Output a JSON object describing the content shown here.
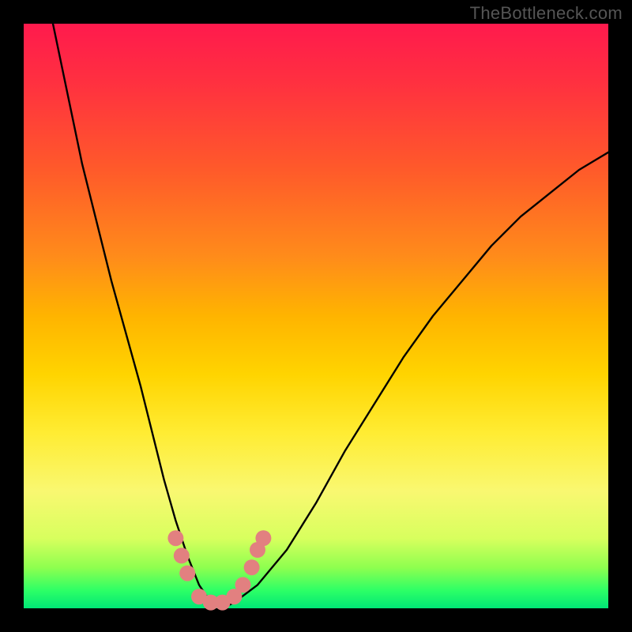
{
  "watermark": "TheBottleneck.com",
  "chart_data": {
    "type": "line",
    "title": "",
    "xlabel": "",
    "ylabel": "",
    "xlim": [
      0,
      100
    ],
    "ylim": [
      0,
      100
    ],
    "grid": false,
    "legend": false,
    "series": [
      {
        "name": "bottleneck-curve",
        "color": "#000000",
        "x": [
          5,
          10,
          15,
          20,
          24,
          26,
          28,
          30,
          32,
          34,
          36,
          40,
          45,
          50,
          55,
          60,
          65,
          70,
          75,
          80,
          85,
          90,
          95,
          100
        ],
        "y": [
          100,
          76,
          56,
          38,
          22,
          15,
          9,
          4,
          1,
          0,
          1,
          4,
          10,
          18,
          27,
          35,
          43,
          50,
          56,
          62,
          67,
          71,
          75,
          78
        ]
      }
    ],
    "markers": [
      {
        "name": "highlight-dots",
        "color": "#e28080",
        "radius": 10,
        "points": [
          {
            "x": 26,
            "y": 12
          },
          {
            "x": 27,
            "y": 9
          },
          {
            "x": 28,
            "y": 6
          },
          {
            "x": 30,
            "y": 2
          },
          {
            "x": 32,
            "y": 1
          },
          {
            "x": 34,
            "y": 1
          },
          {
            "x": 36,
            "y": 2
          },
          {
            "x": 37.5,
            "y": 4
          },
          {
            "x": 39,
            "y": 7
          },
          {
            "x": 40,
            "y": 10
          },
          {
            "x": 41,
            "y": 12
          }
        ]
      }
    ],
    "gradient_stops": [
      {
        "pos": 0,
        "color": "#ff1a4d"
      },
      {
        "pos": 10,
        "color": "#ff3040"
      },
      {
        "pos": 25,
        "color": "#ff5a2a"
      },
      {
        "pos": 40,
        "color": "#ff8c1a"
      },
      {
        "pos": 50,
        "color": "#ffb400"
      },
      {
        "pos": 60,
        "color": "#ffd400"
      },
      {
        "pos": 70,
        "color": "#ffec33"
      },
      {
        "pos": 80,
        "color": "#f9f871"
      },
      {
        "pos": 88,
        "color": "#d8ff5e"
      },
      {
        "pos": 93,
        "color": "#8fff4f"
      },
      {
        "pos": 97,
        "color": "#2cff66"
      },
      {
        "pos": 100,
        "color": "#00e676"
      }
    ]
  }
}
